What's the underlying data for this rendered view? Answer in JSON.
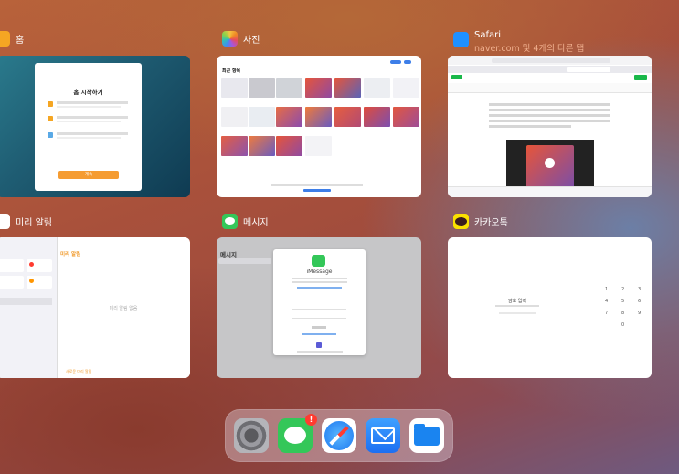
{
  "apps": {
    "home": {
      "name": "홈",
      "content": {
        "title": "홈 시작하기",
        "button": "계속"
      }
    },
    "photos": {
      "name": "사진",
      "content": {
        "album": "최근 항목"
      }
    },
    "safari": {
      "name": "Safari",
      "subtitle": "naver.com 및 4개의 다른 탭"
    },
    "reminders": {
      "name": "미리 알림",
      "content": {
        "list_title": "미리 알림",
        "empty": "미리 알림 없음",
        "new": "새로운 미리 알림"
      }
    },
    "messages": {
      "name": "메시지",
      "content": {
        "header": "메시지",
        "dialog_title": "iMessage"
      }
    },
    "kakaotalk": {
      "name": "카카오톡",
      "content": {
        "passcode_title": "암호 입력",
        "keys": [
          "1",
          "2",
          "3",
          "4",
          "5",
          "6",
          "7",
          "8",
          "9",
          "0"
        ]
      }
    }
  },
  "dock": {
    "items": [
      {
        "name": "settings-icon",
        "color": "#8e8e93"
      },
      {
        "name": "messages-icon",
        "color": "#34c759",
        "badge": "!"
      },
      {
        "name": "safari-icon",
        "color": "#1e90ff"
      },
      {
        "name": "mail-icon",
        "color": "#2f7bf6"
      },
      {
        "name": "files-icon",
        "color": "#1a84f0"
      }
    ]
  }
}
